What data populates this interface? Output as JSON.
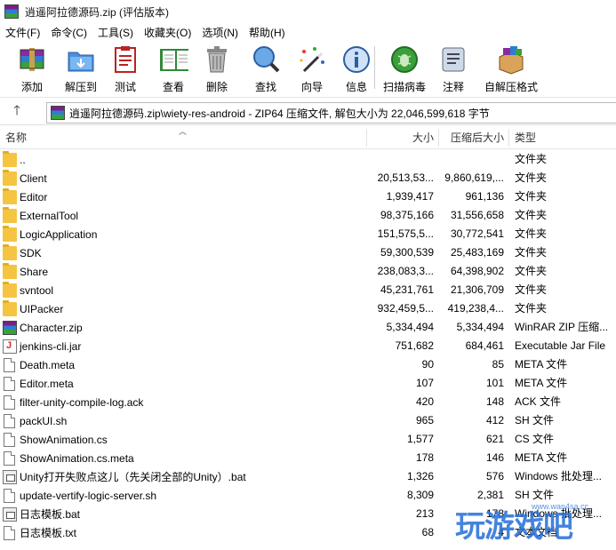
{
  "window": {
    "title": "逍遥阿拉德源码.zip (评估版本)"
  },
  "menu": [
    {
      "label": "文件(F)"
    },
    {
      "label": "命令(C)"
    },
    {
      "label": "工具(S)"
    },
    {
      "label": "收藏夹(O)"
    },
    {
      "label": "选项(N)"
    },
    {
      "label": "帮助(H)"
    }
  ],
  "toolbar": [
    {
      "label": "添加",
      "icon": "add-archive-icon"
    },
    {
      "label": "解压到",
      "icon": "extract-to-icon"
    },
    {
      "label": "测试",
      "icon": "test-icon"
    },
    {
      "label": "查看",
      "icon": "view-icon"
    },
    {
      "label": "删除",
      "icon": "delete-icon"
    },
    {
      "label": "查找",
      "icon": "find-icon"
    },
    {
      "label": "向导",
      "icon": "wizard-icon"
    },
    {
      "label": "信息",
      "icon": "info-icon"
    },
    {
      "label": "扫描病毒",
      "icon": "virus-scan-icon"
    },
    {
      "label": "注释",
      "icon": "comment-icon"
    },
    {
      "label": "自解压格式",
      "icon": "sfx-icon"
    }
  ],
  "address": {
    "path": "逍遥阿拉德源码.zip\\wiety-res-android - ZIP64 压缩文件, 解包大小为 22,046,599,618 字节"
  },
  "columns": {
    "name": "名称",
    "size": "大小",
    "packed": "压缩后大小",
    "type": "类型"
  },
  "files": [
    {
      "name": "..",
      "size": "",
      "packed": "",
      "type": "文件夹",
      "kind": "folder"
    },
    {
      "name": "Client",
      "size": "20,513,53...",
      "packed": "9,860,619,...",
      "type": "文件夹",
      "kind": "folder"
    },
    {
      "name": "Editor",
      "size": "1,939,417",
      "packed": "961,136",
      "type": "文件夹",
      "kind": "folder"
    },
    {
      "name": "ExternalTool",
      "size": "98,375,166",
      "packed": "31,556,658",
      "type": "文件夹",
      "kind": "folder"
    },
    {
      "name": "LogicApplication",
      "size": "151,575,5...",
      "packed": "30,772,541",
      "type": "文件夹",
      "kind": "folder"
    },
    {
      "name": "SDK",
      "size": "59,300,539",
      "packed": "25,483,169",
      "type": "文件夹",
      "kind": "folder"
    },
    {
      "name": "Share",
      "size": "238,083,3...",
      "packed": "64,398,902",
      "type": "文件夹",
      "kind": "folder"
    },
    {
      "name": "svntool",
      "size": "45,231,761",
      "packed": "21,306,709",
      "type": "文件夹",
      "kind": "folder"
    },
    {
      "name": "UIPacker",
      "size": "932,459,5...",
      "packed": "419,238,4...",
      "type": "文件夹",
      "kind": "folder"
    },
    {
      "name": "Character.zip",
      "size": "5,334,494",
      "packed": "5,334,494",
      "type": "WinRAR ZIP 压缩...",
      "kind": "zip"
    },
    {
      "name": "jenkins-cli.jar",
      "size": "751,682",
      "packed": "684,461",
      "type": "Executable Jar File",
      "kind": "jar"
    },
    {
      "name": "Death.meta",
      "size": "90",
      "packed": "85",
      "type": "META 文件",
      "kind": "doc"
    },
    {
      "name": "Editor.meta",
      "size": "107",
      "packed": "101",
      "type": "META 文件",
      "kind": "doc"
    },
    {
      "name": "filter-unity-compile-log.ack",
      "size": "420",
      "packed": "148",
      "type": "ACK 文件",
      "kind": "doc"
    },
    {
      "name": "packUI.sh",
      "size": "965",
      "packed": "412",
      "type": "SH 文件",
      "kind": "doc"
    },
    {
      "name": "ShowAnimation.cs",
      "size": "1,577",
      "packed": "621",
      "type": "CS 文件",
      "kind": "doc"
    },
    {
      "name": "ShowAnimation.cs.meta",
      "size": "178",
      "packed": "146",
      "type": "META 文件",
      "kind": "doc"
    },
    {
      "name": "Unity打开失败点这儿（先关闭全部的Unity）.bat",
      "size": "1,326",
      "packed": "576",
      "type": "Windows 批处理...",
      "kind": "bat"
    },
    {
      "name": "update-vertify-logic-server.sh",
      "size": "8,309",
      "packed": "2,381",
      "type": "SH 文件",
      "kind": "doc"
    },
    {
      "name": "日志模板.bat",
      "size": "213",
      "packed": "178",
      "type": "Windows 批处理...",
      "kind": "bat"
    },
    {
      "name": "日志模板.txt",
      "size": "68",
      "packed": "4",
      "type": "文本文档",
      "kind": "doc"
    }
  ],
  "watermark": {
    "text": "玩游戏吧",
    "url": "www.wan4sa.cc"
  }
}
